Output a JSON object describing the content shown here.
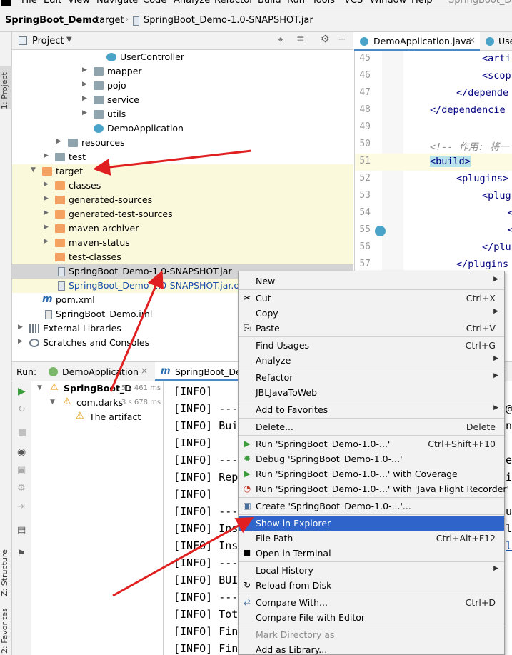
{
  "menubar": {
    "items": [
      "File",
      "Edit",
      "View",
      "Navigate",
      "Code",
      "Analyze",
      "Refactor",
      "Build",
      "Run",
      "Tools",
      "VCS",
      "Window",
      "Help"
    ],
    "window_title": "SpringBoot_Demo"
  },
  "breadcrumb": [
    "SpringBoot_Demo",
    "target",
    "SpringBoot_Demo-1.0-SNAPSHOT.jar"
  ],
  "left_strip": {
    "project_tab": "1: Project",
    "structure_tab": "Z: Structure",
    "favorites_tab": "2: Favorites"
  },
  "project_panel": {
    "title": "Project",
    "tree": [
      {
        "label": "UserController",
        "kind": "class"
      },
      {
        "label": "mapper",
        "kind": "package"
      },
      {
        "label": "pojo",
        "kind": "package"
      },
      {
        "label": "service",
        "kind": "package"
      },
      {
        "label": "utils",
        "kind": "package"
      },
      {
        "label": "DemoApplication",
        "kind": "class"
      },
      {
        "label": "resources",
        "kind": "folder"
      },
      {
        "label": "test",
        "kind": "folder"
      },
      {
        "label": "target",
        "kind": "folder-orange"
      },
      {
        "label": "classes",
        "kind": "folder-orange"
      },
      {
        "label": "generated-sources",
        "kind": "folder-orange"
      },
      {
        "label": "generated-test-sources",
        "kind": "folder-orange"
      },
      {
        "label": "maven-archiver",
        "kind": "folder-orange"
      },
      {
        "label": "maven-status",
        "kind": "folder-orange"
      },
      {
        "label": "test-classes",
        "kind": "folder-orange"
      },
      {
        "label": "SpringBoot_Demo-1.0-SNAPSHOT.jar",
        "kind": "jar"
      },
      {
        "label": "SpringBoot_Demo-1.0-SNAPSHOT.jar.orig",
        "kind": "jar"
      },
      {
        "label": "pom.xml",
        "kind": "maven"
      },
      {
        "label": "SpringBoot_Demo.iml",
        "kind": "iml"
      },
      {
        "label": "External Libraries",
        "kind": "libs"
      },
      {
        "label": "Scratches and Consoles",
        "kind": "scratch"
      }
    ]
  },
  "editor": {
    "tabs": [
      "DemoApplication.java",
      "Use"
    ],
    "lines": [
      {
        "n": "45",
        "code": "<arti"
      },
      {
        "n": "46",
        "code": "<scop"
      },
      {
        "n": "47",
        "code": "</depende"
      },
      {
        "n": "48",
        "code": "</dependencie"
      },
      {
        "n": "49",
        "code": ""
      },
      {
        "n": "50",
        "code": "<!-- 作用: 将一"
      },
      {
        "n": "51",
        "code": "<build>"
      },
      {
        "n": "52",
        "code": "<plugins>"
      },
      {
        "n": "53",
        "code": "<plug"
      },
      {
        "n": "54",
        "code": "<"
      },
      {
        "n": "55",
        "code": "<"
      },
      {
        "n": "56",
        "code": "</plu"
      },
      {
        "n": "57",
        "code": "</plugins"
      }
    ]
  },
  "run_panel": {
    "label": "Run:",
    "tabs": [
      "DemoApplication",
      "SpringBoot_De"
    ],
    "tree": [
      {
        "label": "SpringBoot_D",
        "time": "5 s 461 ms"
      },
      {
        "label": "com.darks",
        "time": "3 s 678 ms"
      },
      {
        "label": "The artifact mysql",
        "time": ""
      }
    ],
    "console": [
      "[INFO]",
      "[INFO] ---",
      "[INFO] Bui",
      "[INFO]",
      "[INFO] ---",
      "[INFO] Rep",
      "[INFO]",
      "[INFO] ---",
      "[INFO] Ins",
      "[INFO] Ins",
      "[INFO] ---",
      "[INFO] BUI",
      "[INFO] ---",
      "[INFO] Tot",
      "[INFO] Fin",
      "[INFO] Fin"
    ],
    "console_right": [
      "@",
      "nv",
      "e",
      "iv",
      "ul",
      "l\\",
      "l\\"
    ]
  },
  "context_menu": {
    "items": [
      {
        "label": "New",
        "shortcut": "",
        "sub": true,
        "icon": ""
      },
      {
        "label": "Cut",
        "shortcut": "Ctrl+X",
        "sub": false,
        "icon": "scissors-icon"
      },
      {
        "label": "Copy",
        "shortcut": "",
        "sub": true,
        "icon": ""
      },
      {
        "label": "Paste",
        "shortcut": "Ctrl+V",
        "sub": false,
        "icon": "paste-icon"
      },
      {
        "label": "Find Usages",
        "shortcut": "Ctrl+G",
        "sub": false,
        "icon": ""
      },
      {
        "label": "Analyze",
        "shortcut": "",
        "sub": true,
        "icon": ""
      },
      {
        "label": "Refactor",
        "shortcut": "",
        "sub": true,
        "icon": ""
      },
      {
        "label": "JBLJavaToWeb",
        "shortcut": "",
        "sub": false,
        "icon": ""
      },
      {
        "label": "Add to Favorites",
        "shortcut": "",
        "sub": true,
        "icon": ""
      },
      {
        "label": "Delete...",
        "shortcut": "Delete",
        "sub": false,
        "icon": ""
      },
      {
        "label": "Run 'SpringBoot_Demo-1.0-...'",
        "shortcut": "Ctrl+Shift+F10",
        "sub": false,
        "icon": "run-icon"
      },
      {
        "label": "Debug 'SpringBoot_Demo-1.0-...'",
        "shortcut": "",
        "sub": false,
        "icon": "debug-icon"
      },
      {
        "label": "Run 'SpringBoot_Demo-1.0-...' with Coverage",
        "shortcut": "",
        "sub": false,
        "icon": "coverage-icon"
      },
      {
        "label": "Run 'SpringBoot_Demo-1.0-...' with 'Java Flight Recorder'",
        "shortcut": "",
        "sub": false,
        "icon": "profiler-icon"
      },
      {
        "label": "Create 'SpringBoot_Demo-1.0-...'...",
        "shortcut": "",
        "sub": false,
        "icon": "config-icon"
      },
      {
        "label": "Show in Explorer",
        "shortcut": "",
        "sub": false,
        "icon": ""
      },
      {
        "label": "File Path",
        "shortcut": "Ctrl+Alt+F12",
        "sub": false,
        "icon": ""
      },
      {
        "label": "Open in Terminal",
        "shortcut": "",
        "sub": false,
        "icon": "terminal-icon"
      },
      {
        "label": "Local History",
        "shortcut": "",
        "sub": true,
        "icon": ""
      },
      {
        "label": "Reload from Disk",
        "shortcut": "",
        "sub": false,
        "icon": "reload-icon"
      },
      {
        "label": "Compare With...",
        "shortcut": "Ctrl+D",
        "sub": false,
        "icon": "compare-icon"
      },
      {
        "label": "Compare File with Editor",
        "shortcut": "",
        "sub": false,
        "icon": ""
      },
      {
        "label": "Mark Directory as",
        "shortcut": "",
        "sub": false,
        "icon": ""
      },
      {
        "label": "Add as Library...",
        "shortcut": "",
        "sub": false,
        "icon": ""
      }
    ],
    "highlighted": "Show in Explorer"
  },
  "colors": {
    "selection": "#2f65ca",
    "annotation_arrow": "#e02020",
    "folder_orange": "#f4a261",
    "highlight_row": "#fbf9dc"
  }
}
